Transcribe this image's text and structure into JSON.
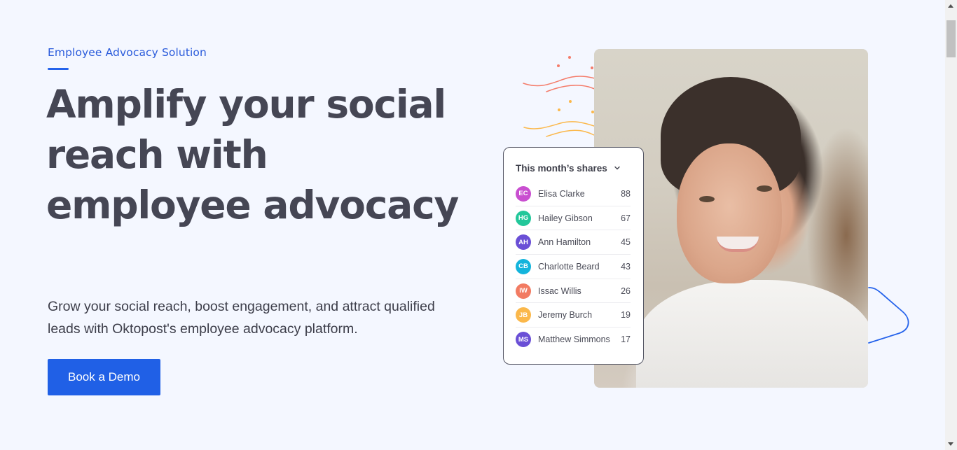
{
  "hero": {
    "eyebrow": "Employee Advocacy Solution",
    "headline": "Amplify your social reach with employee advocacy",
    "subtext": "Grow your social reach, boost engagement, and attract qualified leads with Oktopost's employee advocacy platform.",
    "cta_label": "Book a Demo",
    "accent_color": "#2060e6"
  },
  "shares_card": {
    "title": "This month’s shares",
    "dropdown_icon": "chevron-down-icon",
    "rows": [
      {
        "initials": "EC",
        "name": "Elisa Clarke",
        "count": "88",
        "color": "#c94fd0"
      },
      {
        "initials": "HG",
        "name": "Hailey Gibson",
        "count": "67",
        "color": "#22c79a"
      },
      {
        "initials": "AH",
        "name": "Ann Hamilton",
        "count": "45",
        "color": "#6a4fd6"
      },
      {
        "initials": "CB",
        "name": "Charlotte Beard",
        "count": "43",
        "color": "#13b4dc"
      },
      {
        "initials": "IW",
        "name": "Issac Willis",
        "count": "26",
        "color": "#f27b62"
      },
      {
        "initials": "JB",
        "name": "Jeremy Burch",
        "count": "19",
        "color": "#fbb84b"
      },
      {
        "initials": "MS",
        "name": "Matthew Simmons",
        "count": "17",
        "color": "#6a4fd6"
      }
    ]
  },
  "photo": {
    "description": "Smiling woman in white shirt looking over her shoulder"
  }
}
